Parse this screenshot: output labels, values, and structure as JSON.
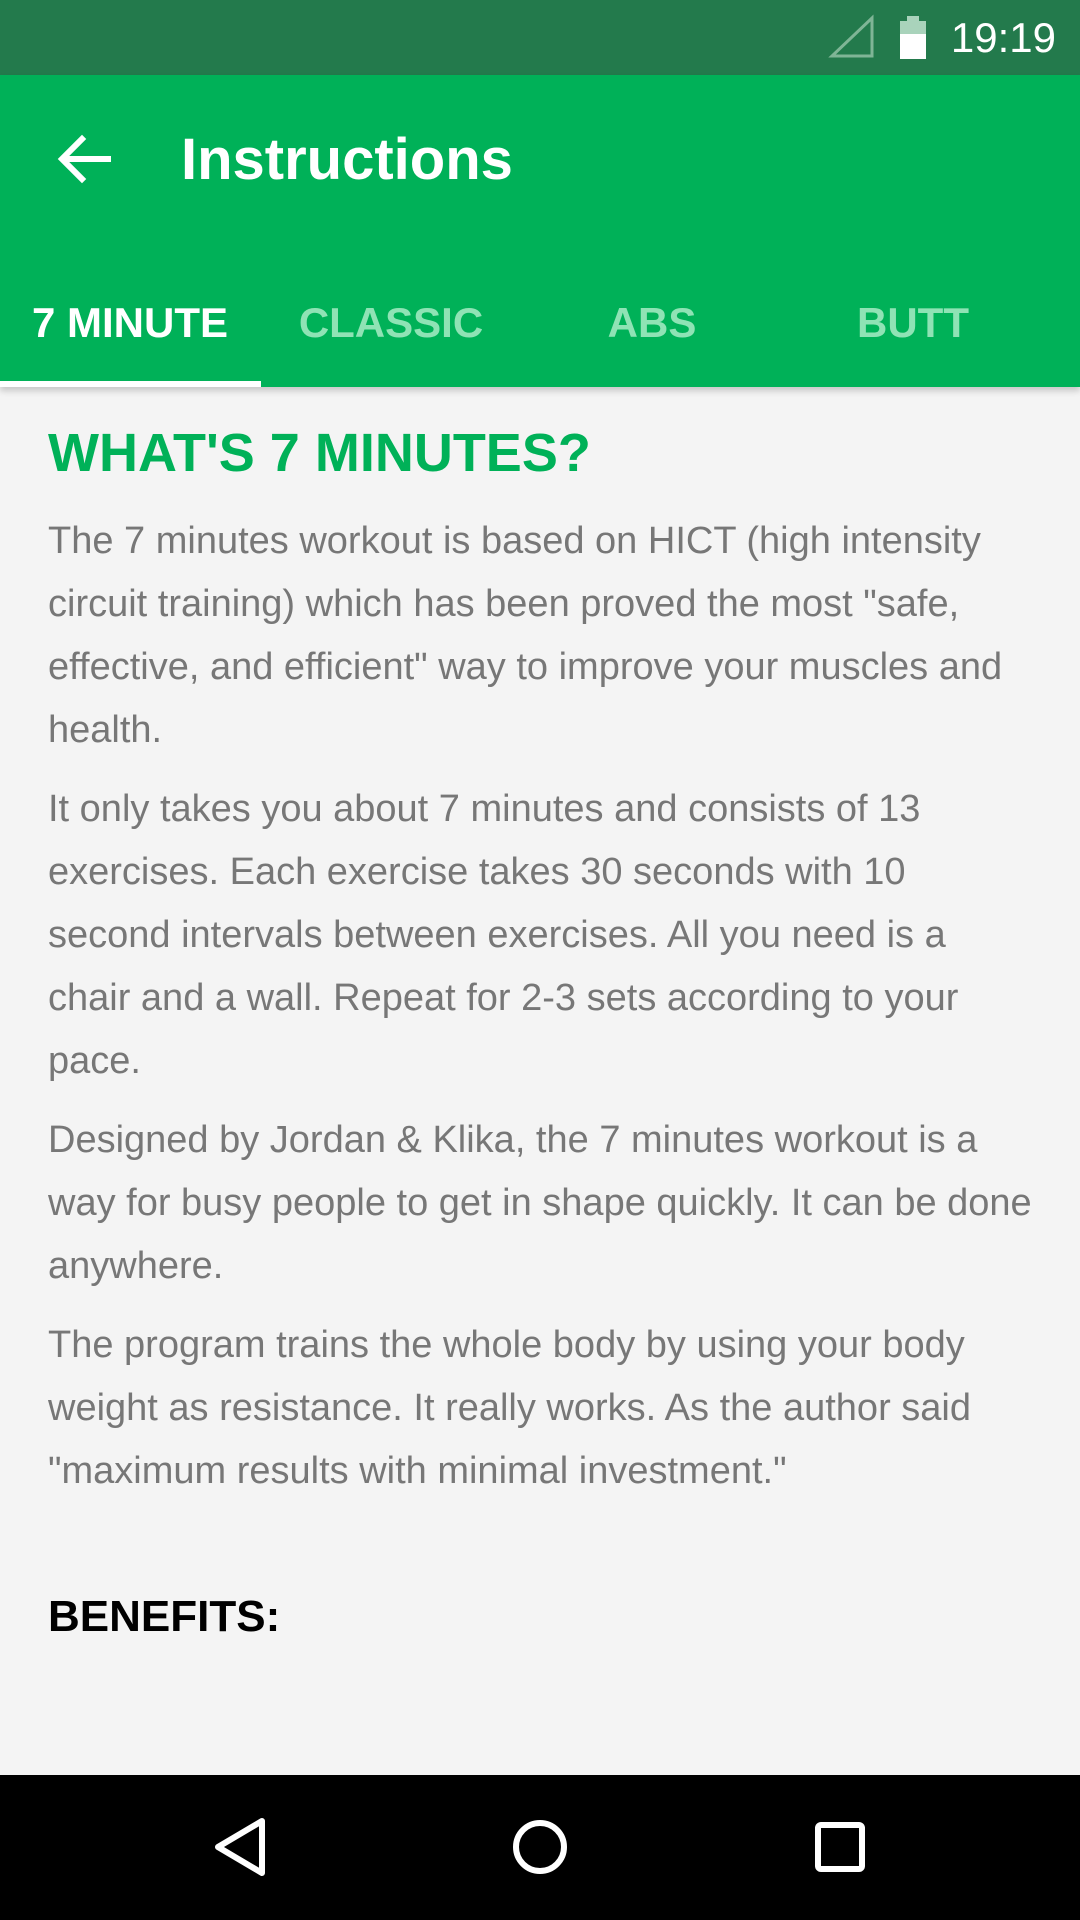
{
  "status_bar": {
    "time": "19:19",
    "icons": [
      "signal-icon",
      "battery-icon"
    ]
  },
  "app_bar": {
    "back_icon": "arrow-back-icon",
    "title": "Instructions"
  },
  "tabs": [
    {
      "label": "7 MINUTE",
      "active": true
    },
    {
      "label": "CLASSIC",
      "active": false
    },
    {
      "label": "ABS",
      "active": false
    },
    {
      "label": "BUTT",
      "active": false
    }
  ],
  "content": {
    "heading": "WHAT'S 7 MINUTES?",
    "paragraphs": [
      "The 7 minutes workout is based on HICT (high intensity circuit training) which has been proved the most \"safe, effective, and efficient\" way to improve your muscles and health.",
      "It only takes you about 7 minutes and consists of 13 exercises. Each exercise takes 30 seconds with 10 second intervals between exercises. All you need is a chair and a wall. Repeat for 2-3 sets according to your pace.",
      "Designed by Jordan & Klika, the 7 minutes workout is a way for busy people to get in shape quickly. It can be done anywhere.",
      "The program trains the whole body by using your body weight as resistance. It really works. As the author said \"maximum results with minimal investment.\""
    ],
    "benefits_heading": "BENEFITS:"
  },
  "nav_bar": {
    "icons": [
      "back-triangle-icon",
      "home-circle-icon",
      "recents-square-icon"
    ]
  },
  "colors": {
    "status_bar": "#237a4c",
    "app_bar": "#00b158",
    "heading": "#00b158",
    "body_text": "#777777",
    "background": "#f4f4f4",
    "tab_inactive": "#8fe3b5"
  }
}
